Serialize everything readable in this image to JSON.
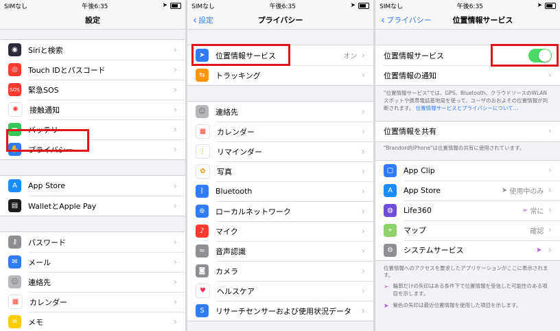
{
  "status": {
    "carrier": "SIMなし",
    "time": "午後6:35"
  },
  "panel1": {
    "title": "設定",
    "group1": [
      {
        "label": "Siriと検索",
        "icon": "siri-icon",
        "color": "#2b2b3a"
      },
      {
        "label": "Touch IDとパスコード",
        "icon": "fingerprint-icon",
        "color": "#ff3b30"
      },
      {
        "label": "緊急SOS",
        "icon": "sos-icon",
        "color": "#ff3b30"
      },
      {
        "label": "接触通知",
        "icon": "exposure-icon",
        "color": "#ffffff"
      },
      {
        "label": "バッテリー",
        "icon": "battery-icon",
        "color": "#34c759"
      },
      {
        "label": "プライバシー",
        "icon": "hand-icon",
        "color": "#2f7cf6"
      }
    ],
    "group2": [
      {
        "label": "App Store",
        "icon": "appstore-icon",
        "color": "#1a8cff"
      },
      {
        "label": "WalletとApple Pay",
        "icon": "wallet-icon",
        "color": "#1c1c1e"
      }
    ],
    "group3": [
      {
        "label": "パスワード",
        "icon": "key-icon",
        "color": "#8e8e93"
      },
      {
        "label": "メール",
        "icon": "mail-icon",
        "color": "#2f7cf6"
      },
      {
        "label": "連絡先",
        "icon": "contacts-icon",
        "color": "#b7b7bb"
      },
      {
        "label": "カレンダー",
        "icon": "calendar-icon",
        "color": "#ffffff"
      },
      {
        "label": "メモ",
        "icon": "notes-icon",
        "color": "#ffcc00"
      }
    ]
  },
  "panel2": {
    "back": "設定",
    "title": "プライバシー",
    "group1": [
      {
        "label": "位置情報サービス",
        "value": "オン",
        "icon": "location-icon",
        "color": "#2f7cf6"
      },
      {
        "label": "トラッキング",
        "value": "",
        "icon": "tracking-icon",
        "color": "#ff9500"
      }
    ],
    "group2": [
      {
        "label": "連絡先",
        "icon": "contacts-icon",
        "color": "#b7b7bb"
      },
      {
        "label": "カレンダー",
        "icon": "calendar-icon",
        "color": "#ffffff"
      },
      {
        "label": "リマインダー",
        "icon": "reminders-icon",
        "color": "#ffffff"
      },
      {
        "label": "写真",
        "icon": "photos-icon",
        "color": "#ffffff"
      },
      {
        "label": "Bluetooth",
        "icon": "bluetooth-icon",
        "color": "#2f7cf6"
      },
      {
        "label": "ローカルネットワーク",
        "icon": "network-icon",
        "color": "#2f7cf6"
      },
      {
        "label": "マイク",
        "icon": "mic-icon",
        "color": "#ff3b30"
      },
      {
        "label": "音声認識",
        "icon": "waveform-icon",
        "color": "#8e8e93"
      },
      {
        "label": "カメラ",
        "icon": "camera-icon",
        "color": "#8e8e93"
      },
      {
        "label": "ヘルスケア",
        "icon": "health-icon",
        "color": "#ffffff"
      },
      {
        "label": "リサーチセンサーおよび使用状況データ",
        "icon": "research-icon",
        "color": "#2f7cf6"
      }
    ]
  },
  "panel3": {
    "back": "プライバシー",
    "title": "位置情報サービス",
    "toggle_label": "位置情報サービス",
    "alerts_label": "位置情報の通知",
    "note1": "\"位置情報サービス\"では、GPS、Bluetooth、クラウドソースのWLANスポットや携帯電話基地局を使って、ユーザのおおよその位置情報が判断されます。",
    "note1_link": "位置情報サービスとプライバシーについて…",
    "share_label": "位置情報を共有",
    "share_note": "\"Brandon的iPhone\"は位置情報の共有に使用されています。",
    "apps": [
      {
        "label": "App Clip",
        "value": "",
        "icon": "appclip-icon",
        "color": "#2f7cf6",
        "arrow": ""
      },
      {
        "label": "App Store",
        "value": "使用中のみ",
        "icon": "appstore-icon",
        "color": "#1a8cff",
        "arrow": "gray"
      },
      {
        "label": "Life360",
        "value": "常に",
        "icon": "life360-icon",
        "color": "#6c4fd6",
        "arrow": "outline"
      },
      {
        "label": "マップ",
        "value": "確認",
        "icon": "maps-icon",
        "color": "#8fd16a",
        "arrow": ""
      },
      {
        "label": "システムサービス",
        "value": "",
        "icon": "gear-icon",
        "color": "#8e8e93",
        "arrow": "purple"
      }
    ],
    "footer": "位置情報へのアクセスを要求したアプリケーションがここに表示されます。",
    "legend1": "輪郭だけの矢印はある条件下で位置情報を受信した可能性のある項目を示します。",
    "legend2": "紫色の矢印は最近位置情報を使用した項目を示します。"
  }
}
